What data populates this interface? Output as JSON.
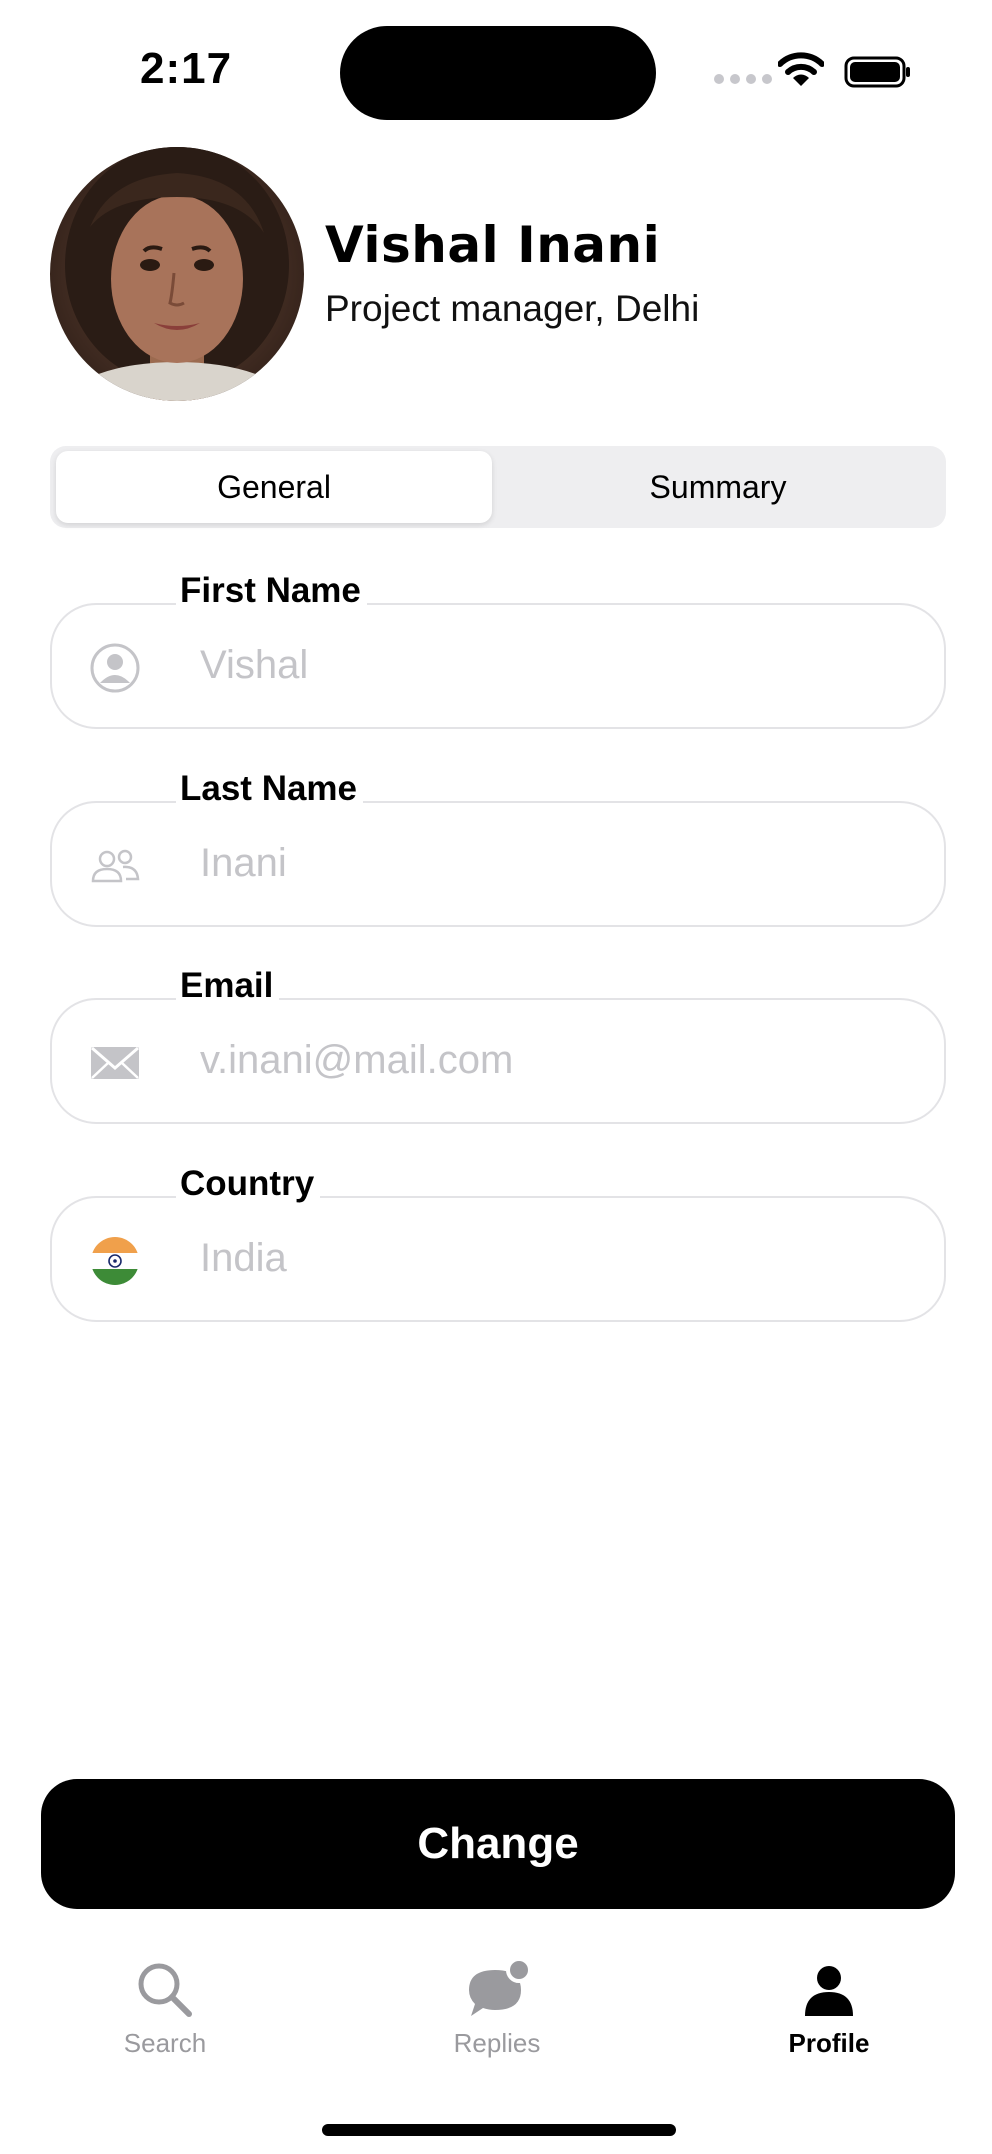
{
  "status_bar": {
    "time": "2:17"
  },
  "profile": {
    "name": "Vishal Inani",
    "subtitle": "Project manager, Delhi",
    "avatar": "user-photo"
  },
  "segments": {
    "general": "General",
    "summary": "Summary",
    "selected": "General"
  },
  "fields": {
    "first_name": {
      "label": "First Name",
      "value": "Vishal",
      "icon": "person-icon"
    },
    "last_name": {
      "label": "Last Name",
      "value": "Inani",
      "icon": "two-people-icon"
    },
    "email": {
      "label": "Email",
      "value": "v.inani@mail.com",
      "icon": "envelope-icon"
    },
    "country": {
      "label": "Country",
      "value": "India",
      "icon": "india-flag-icon"
    }
  },
  "actions": {
    "change_label": "Change"
  },
  "tab_bar": {
    "search": "Search",
    "replies": "Replies",
    "profile": "Profile",
    "active": "Profile"
  },
  "colors": {
    "placeholder": "#c4c4c8",
    "border": "#e3e3e6",
    "primary": "#000000",
    "tab_inactive": "#9a9a9e"
  }
}
